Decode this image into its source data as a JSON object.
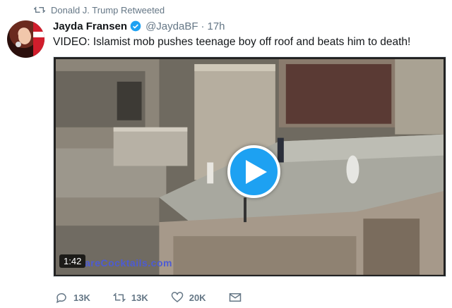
{
  "context": {
    "icon": "retweet-icon",
    "text": "Donald J. Trump Retweeted"
  },
  "tweet": {
    "name": "Jayda Fransen",
    "verified": true,
    "handle": "@JaydaBF",
    "separator": "·",
    "time": "17h",
    "text": "VIDEO: Islamist mob pushes teenage boy off roof and beats him to death!"
  },
  "video": {
    "duration": "1:42",
    "watermark": "areCocktails.com",
    "play_icon": "play-icon"
  },
  "actions": {
    "reply_count": "13K",
    "retweet_count": "13K",
    "like_count": "20K"
  },
  "colors": {
    "accent": "#1da1f2",
    "muted": "#657786",
    "text": "#14171a"
  }
}
